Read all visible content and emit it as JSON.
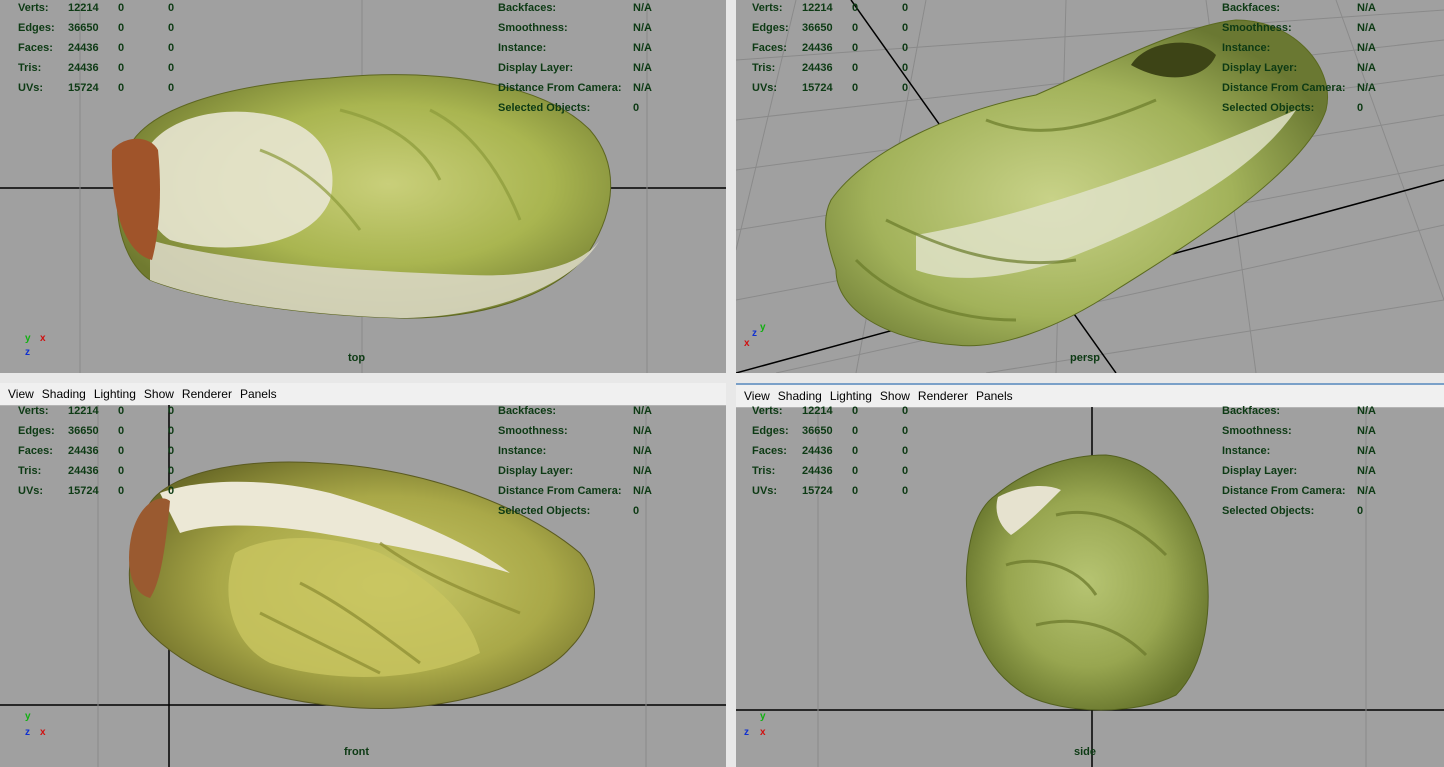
{
  "menu": [
    "View",
    "Shading",
    "Lighting",
    "Show",
    "Renderer",
    "Panels"
  ],
  "hud_left": [
    {
      "label": "Verts:",
      "v1": "12214",
      "v2": "0",
      "v3": "0"
    },
    {
      "label": "Edges:",
      "v1": "36650",
      "v2": "0",
      "v3": "0"
    },
    {
      "label": "Faces:",
      "v1": "24436",
      "v2": "0",
      "v3": "0"
    },
    {
      "label": "Tris:",
      "v1": "24436",
      "v2": "0",
      "v3": "0"
    },
    {
      "label": "UVs:",
      "v1": "15724",
      "v2": "0",
      "v3": "0"
    }
  ],
  "hud_right": [
    {
      "label": "Backfaces:",
      "value": "N/A"
    },
    {
      "label": "Smoothness:",
      "value": "N/A"
    },
    {
      "label": "Instance:",
      "value": "N/A"
    },
    {
      "label": "Display Layer:",
      "value": "N/A"
    },
    {
      "label": "Distance From Camera:",
      "value": "N/A"
    },
    {
      "label": "Selected Objects:",
      "value": "0"
    }
  ],
  "viewports": {
    "top": {
      "camera": "top",
      "axis_a": "y",
      "axis_b": "x",
      "axis_c": "z"
    },
    "persp": {
      "camera": "persp",
      "axis_a": "y",
      "axis_b": "x",
      "axis_c": "z"
    },
    "front": {
      "camera": "front",
      "axis_a": "y",
      "axis_b": "x",
      "axis_c": "z"
    },
    "side": {
      "camera": "side",
      "axis_a": "y",
      "axis_b": "z",
      "axis_c": "x"
    }
  },
  "colors": {
    "viewport_bg": "#a0a0a0",
    "hud_text": "#0d3a14",
    "axis_x": "#d01010",
    "axis_y": "#10b010",
    "axis_z": "#1030d0"
  }
}
